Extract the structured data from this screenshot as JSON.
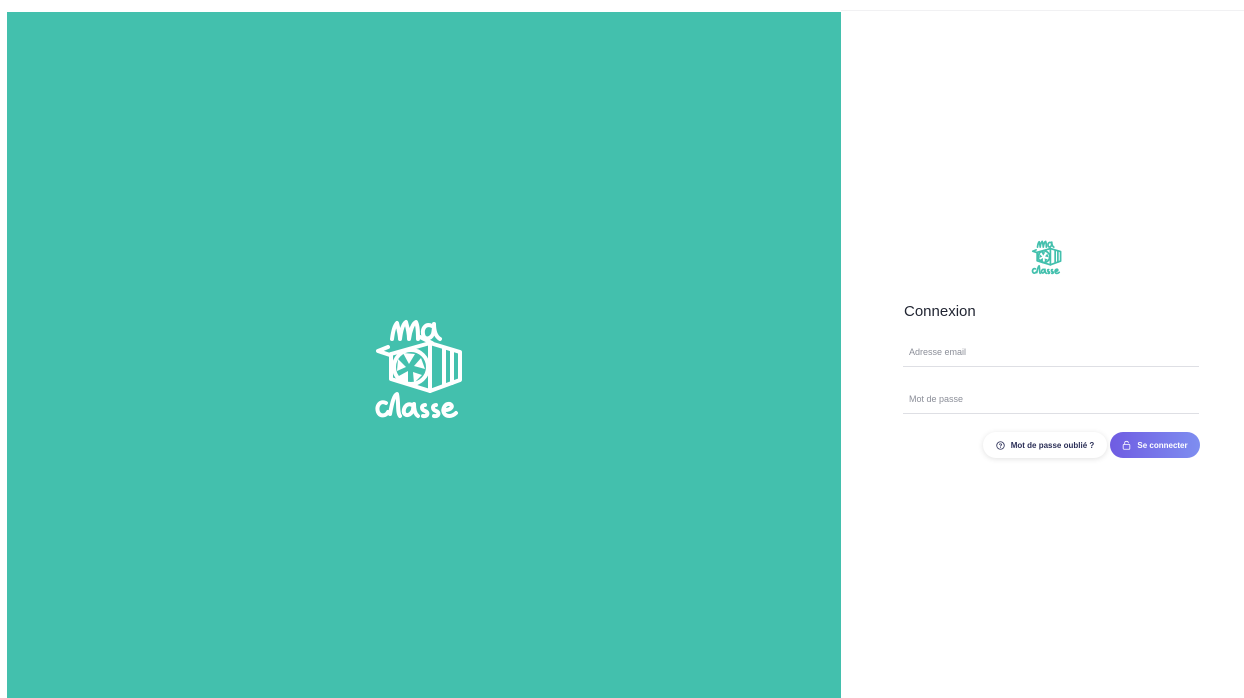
{
  "branding": {
    "logo_text_top": "ma",
    "logo_text_bottom": "classe"
  },
  "login": {
    "title": "Connexion",
    "email_placeholder": "Adresse email",
    "email_value": "",
    "password_placeholder": "Mot de passe",
    "password_value": "",
    "forgot_label": "Mot de passe oublié ?",
    "submit_label": "Se connecter"
  },
  "icons": {
    "forgot": "help-circle-icon",
    "submit": "lock-icon"
  },
  "colors": {
    "brand_teal": "#43c0ad",
    "button_purple": "#6f5ce2",
    "button_purple_light": "#7e8ef0",
    "title_text": "#222633"
  }
}
